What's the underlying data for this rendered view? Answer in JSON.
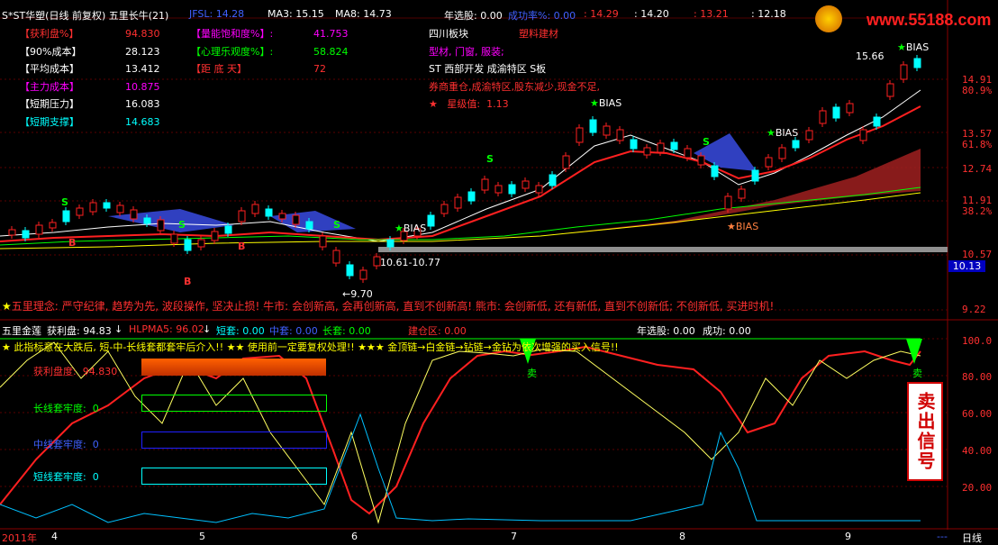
{
  "header": {
    "stock": "S*ST华塑(日线 前复权) 五里长牛(21)",
    "jfsl": "JFSL: 14.28",
    "ma3": "MA3: 15.15",
    "ma8": "MA8: 14.73",
    "year_pick": "年选股: 0.00",
    "success_rate": "成功率%: 0.00",
    "v1": ": 14.29",
    "v2": ": 14.20",
    "v3": ": 13.21",
    "v4": ": 12.18"
  },
  "logo": {
    "site": "www.55188.com"
  },
  "stats_left": [
    {
      "label": "【获利盘%】",
      "value": "94.830"
    },
    {
      "label": "【90%成本】",
      "value": "28.123"
    },
    {
      "label": "【平均成本】",
      "value": "13.412"
    },
    {
      "label": "【主力成本】",
      "value": "10.875"
    },
    {
      "label": "【短期压力】",
      "value": "16.083"
    },
    {
      "label": "【短期支撑】",
      "value": "14.683"
    }
  ],
  "stats_mid": [
    {
      "label": "【量能饱和度%】:",
      "value": "41.753"
    },
    {
      "label": "【心理乐观度%】:",
      "value": "58.824"
    },
    {
      "label": "【距  底  天】",
      "value": "72"
    }
  ],
  "info": {
    "sector": "四川板块",
    "industry": "塑料建材",
    "tags": "型材, 门窗, 服装;",
    "concepts": "ST 西部开发 成渝特区 S板",
    "notes": "券商重仓,成渝特区,股东减少,现金不足,",
    "star_label": "星级值:",
    "star_value": "1.13"
  },
  "annotations": {
    "peak": "15.66",
    "bias_top": "BIAS",
    "bias_1": "BIAS",
    "bias_2": "BIAS",
    "bias_3": "BIAS",
    "bias_low": "BIAS",
    "range": "10.61-10.77",
    "low": "9.70",
    "s_mark": "S",
    "b_mark": "B"
  },
  "philosophy": "五里理念: 严守纪律, 趋势为先, 波段操作, 坚决止损! 牛市: 会创新高, 会再创新高, 直到不创新高! 熊市: 会创新低, 还有新低, 直到不创新低; 不创新低, 买进时机!",
  "price_axis": [
    {
      "label": "14.91"
    },
    {
      "label": "80.9%"
    },
    {
      "label": "13.57"
    },
    {
      "label": "61.8%"
    },
    {
      "label": "12.74"
    },
    {
      "label": "11.91"
    },
    {
      "label": "38.2%"
    },
    {
      "label": "10.57"
    },
    {
      "label": "9.22"
    }
  ],
  "current_price": "10.13",
  "sub": {
    "title": "五里金莲",
    "profit": "获利盘: 94.83",
    "hlpma5": "HLPMA5: 96.02",
    "short": "短套: 0.00",
    "mid": "中套: 0.00",
    "long": "长套: 0.00",
    "build": "建仓区: 0.00",
    "year_pick": "年选股: 0.00",
    "success": "成功: 0.00",
    "tip": "★ 此指标意在大跌后, 短-中-长线套都套牢后介入!!  ★★ 使用前一定要复权处理!!  ★★★ 金顶链→白金链→钻链→金钻为依次增强的买入信号!!",
    "sell_mark": "卖",
    "bars": [
      {
        "label": "获利盘度:",
        "value": "94.830"
      },
      {
        "label": "长线套牢度:",
        "value": "0"
      },
      {
        "label": "中线套牢度:",
        "value": "0"
      },
      {
        "label": "短线套牢度:",
        "value": "0"
      }
    ],
    "axis": [
      {
        "label": "100.0"
      },
      {
        "label": "80.00"
      },
      {
        "label": "60.00"
      },
      {
        "label": "40.00"
      },
      {
        "label": "20.00"
      }
    ],
    "sell_signal": "卖出信号"
  },
  "bottom": {
    "year": "2011年",
    "months": [
      "4",
      "5",
      "6",
      "7",
      "8",
      "9"
    ],
    "period": "日线",
    "dots": "---"
  },
  "colors": {
    "up": "#ff2020",
    "down": "#00ffff",
    "ma_white": "#ffffff",
    "ma_yellow": "#ffff00",
    "cloud": "#3040c0"
  }
}
